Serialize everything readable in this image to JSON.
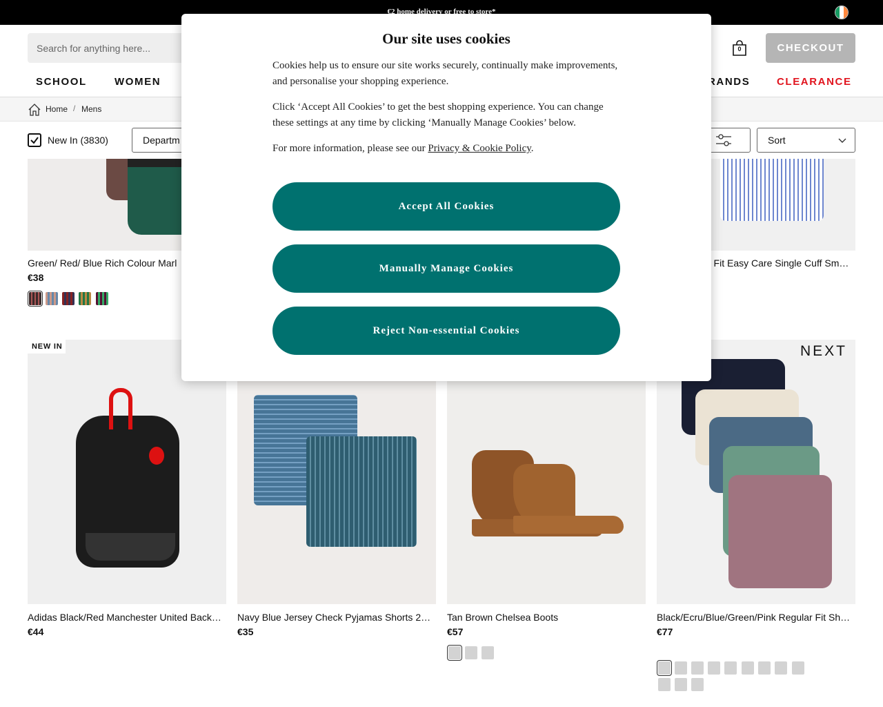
{
  "banner": {
    "promo": "€2 home delivery or free to store*",
    "flag_colors": [
      "#169b62",
      "#ffffff",
      "#ff883e"
    ]
  },
  "header": {
    "search_placeholder": "Search for anything here...",
    "bag_count": "0",
    "checkout_label": "CHECKOUT"
  },
  "nav": {
    "items": [
      "SCHOOL",
      "WOMEN",
      "RANDS",
      "CLEARANCE"
    ]
  },
  "breadcrumb": [
    "Home",
    "Mens"
  ],
  "filters": {
    "new_in": "New In (3830)",
    "department": "Departm",
    "sort": "Sort"
  },
  "products_row1": [
    {
      "title": "Green/ Red/ Blue Rich Colour Marl",
      "price": "€38"
    },
    {
      "title": "r Fit Easy Care Single Cuff Sm…"
    }
  ],
  "products_row2": [
    {
      "title": "Adidas Black/Red Manchester United Back…",
      "price": "€44",
      "badge": "NEW IN"
    },
    {
      "title": "Navy Blue Jersey Check Pyjamas Shorts 2…",
      "price": "€35"
    },
    {
      "title": "Tan Brown Chelsea Boots",
      "price": "€57"
    },
    {
      "title": "Black/Ecru/Blue/Green/Pink Regular Fit Sh…",
      "price": "€77",
      "brand": "NEXT"
    }
  ],
  "cookie_modal": {
    "title": "Our site uses cookies",
    "p1": "Cookies help us to ensure our site works securely, continually make improvements, and personalise your shopping experience.",
    "p2": "Click ‘Accept All Cookies’ to get the best shopping experience. You can change these settings at any time by clicking ‘Manually Manage Cookies’ below.",
    "p3_prefix": "For more information, please see our ",
    "p3_link": "Privacy & Cookie Policy",
    "p3_suffix": ".",
    "accept": "Accept All Cookies",
    "manage": "Manually Manage Cookies",
    "reject": "Reject Non-essential Cookies",
    "button_color": "#00716f"
  }
}
